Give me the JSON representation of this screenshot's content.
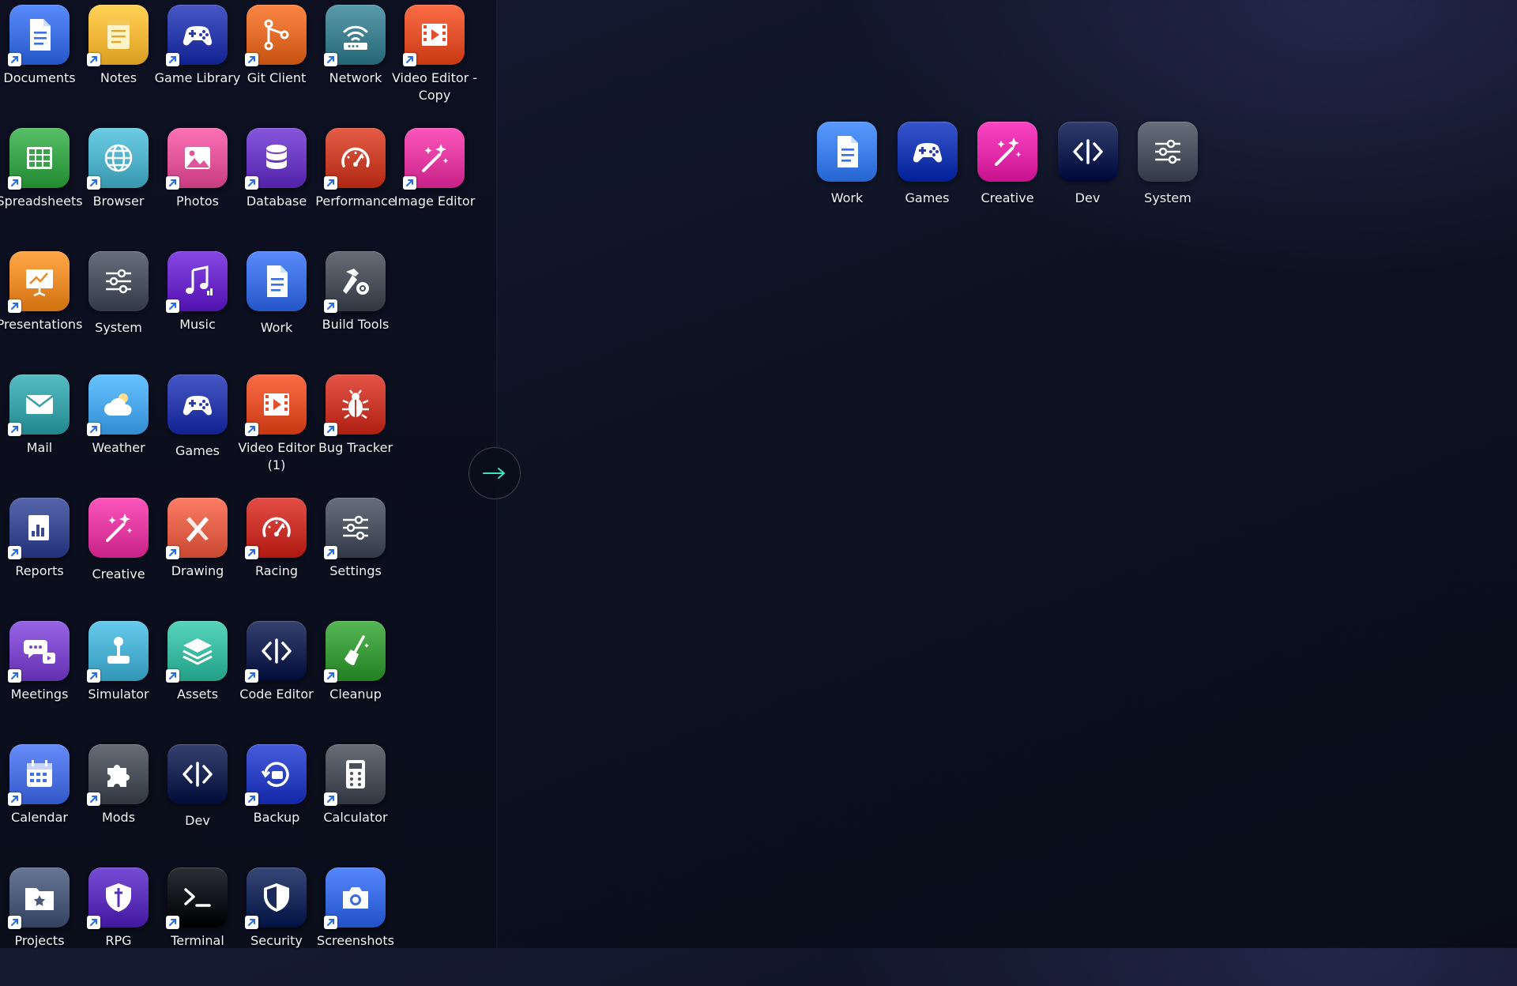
{
  "left_tiles": [
    {
      "id": "documents",
      "label": "Documents",
      "icon": "document-icon",
      "color": "#3d6fe0",
      "shortcut": true
    },
    {
      "id": "notes",
      "label": "Notes",
      "icon": "notepad-icon",
      "color": "#f0b63a",
      "shortcut": true
    },
    {
      "id": "game-library",
      "label": "Game Library",
      "icon": "gamepad-icon",
      "color": "#2a3aa8",
      "shortcut": true
    },
    {
      "id": "git-client",
      "label": "Git Client",
      "icon": "git-branch-icon",
      "color": "#e06a28",
      "shortcut": true
    },
    {
      "id": "network",
      "label": "Network",
      "icon": "router-icon",
      "color": "#3e7f8f",
      "shortcut": true
    },
    {
      "id": "video-editor-copy",
      "label": "Video Editor - Copy",
      "icon": "film-icon",
      "color": "#e0502a",
      "shortcut": true
    },
    {
      "id": "spreadsheets",
      "label": "Spreadsheets",
      "icon": "grid-icon",
      "color": "#3aa34a",
      "shortcut": true
    },
    {
      "id": "browser",
      "label": "Browser",
      "icon": "globe-icon",
      "color": "#4fb0c8",
      "shortcut": true
    },
    {
      "id": "photos",
      "label": "Photos",
      "icon": "image-icon",
      "color": "#e0559a",
      "shortcut": true
    },
    {
      "id": "database",
      "label": "Database",
      "icon": "database-icon",
      "color": "#6a3ac0",
      "shortcut": true
    },
    {
      "id": "performance",
      "label": "Performance",
      "icon": "speedometer-icon",
      "color": "#c8402a",
      "shortcut": true
    },
    {
      "id": "image-editor",
      "label": "Image Editor",
      "icon": "magic-wand-icon",
      "color": "#e03aa0",
      "shortcut": true
    },
    {
      "id": "presentations",
      "label": "Presentations",
      "icon": "presentation-icon",
      "color": "#e88a2a",
      "shortcut": true
    },
    {
      "id": "system",
      "label": "System",
      "icon": "sliders-icon",
      "color": "#4a5260",
      "shortcut": false
    },
    {
      "id": "music",
      "label": "Music",
      "icon": "music-icon",
      "color": "#6a2ac8",
      "shortcut": true
    },
    {
      "id": "work",
      "label": "Work",
      "icon": "document-icon",
      "color": "#3d6fe0",
      "shortcut": false
    },
    {
      "id": "build-tools",
      "label": "Build Tools",
      "icon": "hammer-gear-icon",
      "color": "#4a505a",
      "shortcut": true
    },
    {
      "id": "mail",
      "label": "Mail",
      "icon": "envelope-icon",
      "color": "#3aa0a8",
      "shortcut": true
    },
    {
      "id": "weather",
      "label": "Weather",
      "icon": "cloud-sun-icon",
      "color": "#4aa6e8",
      "shortcut": true
    },
    {
      "id": "games",
      "label": "Games",
      "icon": "gamepad-icon",
      "color": "#2a3aa8",
      "shortcut": false
    },
    {
      "id": "video-editor-1",
      "label": "Video Editor (1)",
      "icon": "film-icon",
      "color": "#e0502a",
      "shortcut": true
    },
    {
      "id": "bug-tracker",
      "label": "Bug Tracker",
      "icon": "bug-icon",
      "color": "#c8382a",
      "shortcut": true
    },
    {
      "id": "reports",
      "label": "Reports",
      "icon": "report-icon",
      "color": "#3a4a90",
      "shortcut": true
    },
    {
      "id": "creative",
      "label": "Creative",
      "icon": "magic-wand-icon",
      "color": "#e03aa0",
      "shortcut": false
    },
    {
      "id": "drawing",
      "label": "Drawing",
      "icon": "pencil-brush-icon",
      "color": "#e0604a",
      "shortcut": true
    },
    {
      "id": "racing",
      "label": "Racing",
      "icon": "speedometer-icon",
      "color": "#c8302a",
      "shortcut": true
    },
    {
      "id": "settings",
      "label": "Settings",
      "icon": "sliders-icon",
      "color": "#4a5260",
      "shortcut": true
    },
    {
      "id": "meetings",
      "label": "Meetings",
      "icon": "chat-bubbles-icon",
      "color": "#7a48c8",
      "shortcut": true
    },
    {
      "id": "simulator",
      "label": "Simulator",
      "icon": "joystick-icon",
      "color": "#4aaed0",
      "shortcut": true
    },
    {
      "id": "assets",
      "label": "Assets",
      "icon": "layers-icon",
      "color": "#3ab8a0",
      "shortcut": true
    },
    {
      "id": "code-editor",
      "label": "Code Editor",
      "icon": "code-icon",
      "color": "#1a2450",
      "shortcut": true
    },
    {
      "id": "cleanup",
      "label": "Cleanup",
      "icon": "broom-icon",
      "color": "#3a9a3a",
      "shortcut": true
    },
    {
      "id": "calendar",
      "label": "Calendar",
      "icon": "calendar-icon",
      "color": "#4a70e0",
      "shortcut": true
    },
    {
      "id": "mods",
      "label": "Mods",
      "icon": "puzzle-icon",
      "color": "#4a505a",
      "shortcut": true
    },
    {
      "id": "dev",
      "label": "Dev",
      "icon": "code-icon",
      "color": "#1a2450",
      "shortcut": false
    },
    {
      "id": "backup",
      "label": "Backup",
      "icon": "backup-icon",
      "color": "#2a40c0",
      "shortcut": true
    },
    {
      "id": "calculator",
      "label": "Calculator",
      "icon": "calculator-icon",
      "color": "#4a505a",
      "shortcut": true
    },
    {
      "id": "projects",
      "label": "Projects",
      "icon": "folder-star-icon",
      "color": "#4a5a78",
      "shortcut": true
    },
    {
      "id": "rpg",
      "label": "RPG",
      "icon": "shield-sword-icon",
      "color": "#5a30b8",
      "shortcut": true
    },
    {
      "id": "terminal",
      "label": "Terminal",
      "icon": "terminal-icon",
      "color": "#111318",
      "shortcut": true
    },
    {
      "id": "security",
      "label": "Security",
      "icon": "shield-icon",
      "color": "#1a2a5a",
      "shortcut": true
    },
    {
      "id": "screenshots",
      "label": "Screenshots",
      "icon": "camera-icon",
      "color": "#3a6ae0",
      "shortcut": true
    }
  ],
  "right_tiles": [
    {
      "id": "work-folder",
      "label": "Work",
      "icon": "document-icon",
      "color": "#3d7ee8"
    },
    {
      "id": "games-folder",
      "label": "Games",
      "icon": "gamepad-icon",
      "color": "#1a38b0"
    },
    {
      "id": "creative-folder",
      "label": "Creative",
      "icon": "magic-wand-icon",
      "color": "#e02aa8"
    },
    {
      "id": "dev-folder",
      "label": "Dev",
      "icon": "code-icon",
      "color": "#142050"
    },
    {
      "id": "system-folder",
      "label": "System",
      "icon": "sliders-icon",
      "color": "#4a5260"
    }
  ],
  "nav": {
    "arrow_icon": "arrow-right-icon",
    "arrow_color": "#3fe0c0"
  }
}
